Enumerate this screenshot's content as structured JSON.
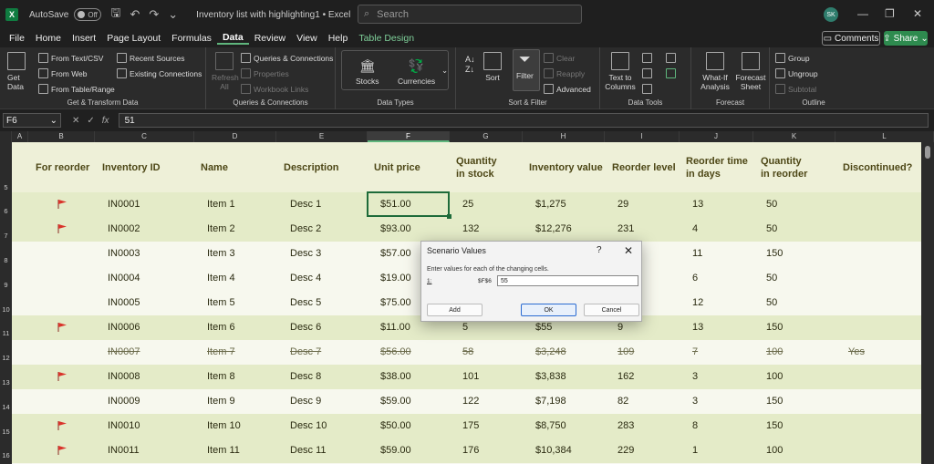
{
  "titlebar": {
    "autosave_label": "AutoSave",
    "toggle_state": "Off",
    "document_title": "Inventory list with highlighting1  •  Excel",
    "search_placeholder": "Search",
    "user_initials": "SK"
  },
  "menu": {
    "items": [
      "File",
      "Home",
      "Insert",
      "Page Layout",
      "Formulas",
      "Data",
      "Review",
      "View",
      "Help",
      "Table Design"
    ],
    "active": "Data",
    "comments_label": "Comments",
    "share_label": "Share"
  },
  "ribbon": {
    "get_transform": {
      "get_data": "Get Data",
      "from_text_csv": "From Text/CSV",
      "from_web": "From Web",
      "from_table_range": "From Table/Range",
      "recent_sources": "Recent Sources",
      "existing_connections": "Existing Connections",
      "label": "Get & Transform Data"
    },
    "queries": {
      "refresh_all": "Refresh All",
      "queries_connections": "Queries & Connections",
      "properties": "Properties",
      "workbook_links": "Workbook Links",
      "label": "Queries & Connections"
    },
    "data_types": {
      "stocks": "Stocks",
      "currencies": "Currencies",
      "label": "Data Types"
    },
    "sort_filter": {
      "sort": "Sort",
      "filter": "Filter",
      "clear": "Clear",
      "reapply": "Reapply",
      "advanced": "Advanced",
      "label": "Sort & Filter"
    },
    "data_tools": {
      "text_to_columns": "Text to Columns",
      "label": "Data Tools"
    },
    "forecast": {
      "what_if": "What-If Analysis",
      "forecast_sheet": "Forecast Sheet",
      "label": "Forecast"
    },
    "outline": {
      "group": "Group",
      "ungroup": "Ungroup",
      "subtotal": "Subtotal",
      "label": "Outline"
    }
  },
  "formula_bar": {
    "name_box": "F6",
    "formula": "51"
  },
  "columns": [
    "A",
    "B",
    "C",
    "D",
    "E",
    "F",
    "G",
    "H",
    "I",
    "J",
    "K",
    "L"
  ],
  "selected_column": "F",
  "row_numbers": [
    "5",
    "6",
    "7",
    "8",
    "9",
    "10",
    "11",
    "12",
    "13",
    "14",
    "15",
    "16"
  ],
  "table": {
    "headers": {
      "for_reorder": "For reorder",
      "inventory_id": "Inventory ID",
      "name": "Name",
      "description": "Description",
      "unit_price": "Unit price",
      "quantity_in_stock_1": "Quantity",
      "quantity_in_stock_2": "in stock",
      "inventory_value": "Inventory value",
      "reorder_level": "Reorder level",
      "reorder_time_1": "Reorder time",
      "reorder_time_2": "in days",
      "quantity_in_reorder_1": "Quantity",
      "quantity_in_reorder_2": "in reorder",
      "discontinued": "Discontinued?"
    },
    "rows": [
      {
        "flag": true,
        "id": "IN0001",
        "name": "Item 1",
        "desc": "Desc 1",
        "price": "$51.00",
        "qty": "25",
        "value": "$1,275",
        "level": "29",
        "days": "13",
        "reorder": "50",
        "disc": "",
        "strike": false
      },
      {
        "flag": true,
        "id": "IN0002",
        "name": "Item 2",
        "desc": "Desc 2",
        "price": "$93.00",
        "qty": "132",
        "value": "$12,276",
        "level": "231",
        "days": "4",
        "reorder": "50",
        "disc": "",
        "strike": false
      },
      {
        "flag": false,
        "id": "IN0003",
        "name": "Item 3",
        "desc": "Desc 3",
        "price": "$57.00",
        "qty": "",
        "value": "",
        "level": "",
        "days": "11",
        "reorder": "150",
        "disc": "",
        "strike": false
      },
      {
        "flag": false,
        "id": "IN0004",
        "name": "Item 4",
        "desc": "Desc 4",
        "price": "$19.00",
        "qty": "",
        "value": "",
        "level": "",
        "days": "6",
        "reorder": "50",
        "disc": "",
        "strike": false
      },
      {
        "flag": false,
        "id": "IN0005",
        "name": "Item 5",
        "desc": "Desc 5",
        "price": "$75.00",
        "qty": "",
        "value": "",
        "level": "",
        "days": "12",
        "reorder": "50",
        "disc": "",
        "strike": false
      },
      {
        "flag": true,
        "id": "IN0006",
        "name": "Item 6",
        "desc": "Desc 6",
        "price": "$11.00",
        "qty": "5",
        "value": "$55",
        "level": "9",
        "days": "13",
        "reorder": "150",
        "disc": "",
        "strike": false
      },
      {
        "flag": false,
        "id": "IN0007",
        "name": "Item 7",
        "desc": "Desc 7",
        "price": "$56.00",
        "qty": "58",
        "value": "$3,248",
        "level": "109",
        "days": "7",
        "reorder": "100",
        "disc": "Yes",
        "strike": true
      },
      {
        "flag": true,
        "id": "IN0008",
        "name": "Item 8",
        "desc": "Desc 8",
        "price": "$38.00",
        "qty": "101",
        "value": "$3,838",
        "level": "162",
        "days": "3",
        "reorder": "100",
        "disc": "",
        "strike": false
      },
      {
        "flag": false,
        "id": "IN0009",
        "name": "Item 9",
        "desc": "Desc 9",
        "price": "$59.00",
        "qty": "122",
        "value": "$7,198",
        "level": "82",
        "days": "3",
        "reorder": "150",
        "disc": "",
        "strike": false
      },
      {
        "flag": true,
        "id": "IN0010",
        "name": "Item 10",
        "desc": "Desc 10",
        "price": "$50.00",
        "qty": "175",
        "value": "$8,750",
        "level": "283",
        "days": "8",
        "reorder": "150",
        "disc": "",
        "strike": false
      },
      {
        "flag": true,
        "id": "IN0011",
        "name": "Item 11",
        "desc": "Desc 11",
        "price": "$59.00",
        "qty": "176",
        "value": "$10,384",
        "level": "229",
        "days": "1",
        "reorder": "100",
        "disc": "",
        "strike": false
      }
    ]
  },
  "dialog": {
    "title": "Scenario Values",
    "help": "?",
    "close": "✕",
    "instruction": "Enter values for each of the changing cells.",
    "row_number": "1:",
    "cell_ref": "$F$6",
    "value": "55",
    "add_label": "Add",
    "ok_label": "OK",
    "cancel_label": "Cancel"
  },
  "colors": {
    "flag": "#d9342b",
    "accent": "#5fb67d",
    "header_text": "#4d4716"
  }
}
